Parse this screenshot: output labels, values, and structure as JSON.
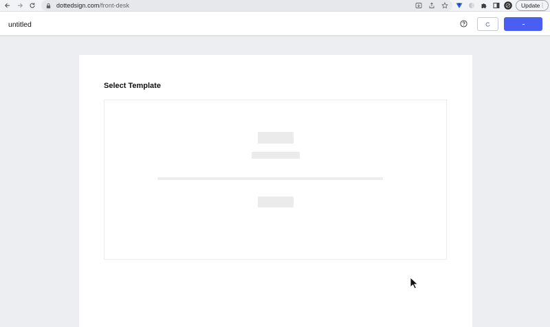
{
  "browser": {
    "url_host": "dottedsign.com",
    "url_path": "/front-desk",
    "update_label": "Update",
    "icons": [
      "back-arrow-icon",
      "forward-arrow-icon",
      "reload-icon",
      "lock-icon",
      "install-icon",
      "share-icon",
      "bookmark-star-icon",
      "vue-extension-icon",
      "extension-icon-gray",
      "puzzle-extensions-icon",
      "side-panel-icon",
      "profile-avatar-icon",
      "more-menu-icon"
    ]
  },
  "app": {
    "document_title": "untitled",
    "accent_color": "#4a5ff2"
  },
  "main": {
    "section_title": "Select Template"
  }
}
